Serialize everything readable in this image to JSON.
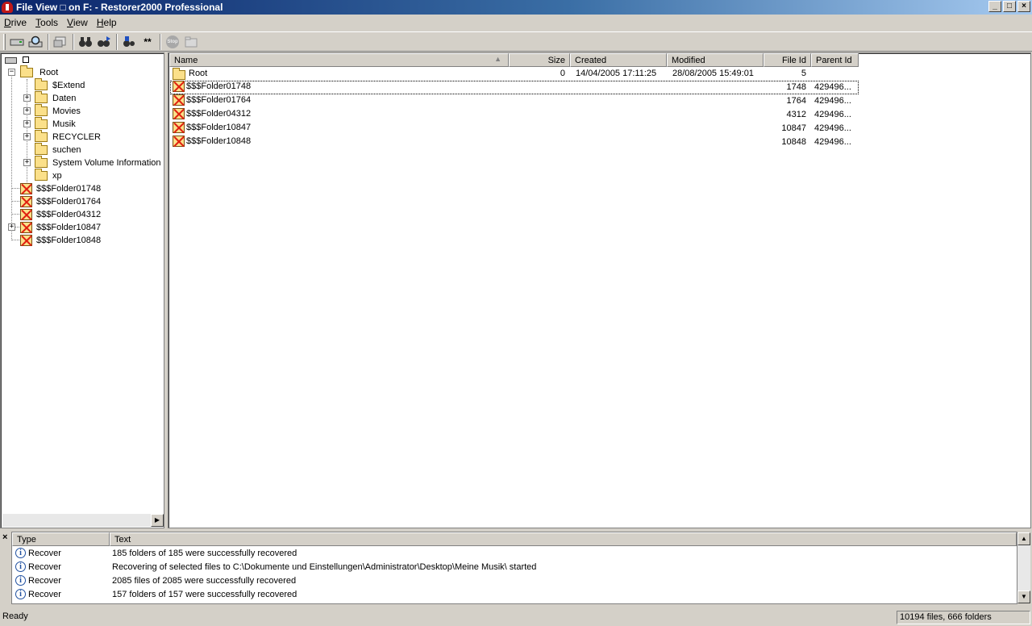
{
  "window": {
    "title": "File View □ on F: - Restorer2000 Professional",
    "controls": {
      "minimize": "_",
      "maximize": "□",
      "close": "×"
    }
  },
  "menu": [
    "Drive",
    "Tools",
    "View",
    "Help"
  ],
  "toolbar": {
    "buttons": [
      "open-drive-icon",
      "scan-icon",
      "recover-icon",
      "find-icon",
      "find-next-icon",
      "mask-icon",
      "wildcard-icon",
      "stop-icon",
      "folder-icon"
    ],
    "wildcard_label": "**",
    "stop_label": "Stop"
  },
  "tree": {
    "root_box": "□",
    "root": "Root",
    "children": [
      "$Extend",
      "Daten",
      "Movies",
      "Musik",
      "RECYCLER",
      "suchen",
      "System Volume Information",
      "xp"
    ],
    "deleted": [
      "$$$Folder01748",
      "$$$Folder01764",
      "$$$Folder04312",
      "$$$Folder10847",
      "$$$Folder10848"
    ],
    "expand_symbol": "+",
    "collapse_symbol": "−"
  },
  "list": {
    "columns": [
      "Name",
      "Size",
      "Created",
      "Modified",
      "File Id",
      "Parent Id"
    ],
    "sort_indicator": "▲",
    "rows": [
      {
        "name": "Root",
        "size": "0",
        "created": "14/04/2005 17:11:25",
        "modified": "28/08/2005 15:49:01",
        "file_id": "5",
        "parent_id": "",
        "deleted": false
      },
      {
        "name": "$$$Folder01748",
        "size": "",
        "created": "",
        "modified": "",
        "file_id": "1748",
        "parent_id": "429496...",
        "deleted": true
      },
      {
        "name": "$$$Folder01764",
        "size": "",
        "created": "",
        "modified": "",
        "file_id": "1764",
        "parent_id": "429496...",
        "deleted": true
      },
      {
        "name": "$$$Folder04312",
        "size": "",
        "created": "",
        "modified": "",
        "file_id": "4312",
        "parent_id": "429496...",
        "deleted": true
      },
      {
        "name": "$$$Folder10847",
        "size": "",
        "created": "",
        "modified": "",
        "file_id": "10847",
        "parent_id": "429496...",
        "deleted": true
      },
      {
        "name": "$$$Folder10848",
        "size": "",
        "created": "",
        "modified": "",
        "file_id": "10848",
        "parent_id": "429496...",
        "deleted": true
      }
    ]
  },
  "log": {
    "close_symbol": "×",
    "columns": [
      "Type",
      "Text"
    ],
    "info_glyph": "i",
    "entries": [
      {
        "type": "Recover",
        "text": "185 folders of 185 were successfully recovered"
      },
      {
        "type": "Recover",
        "text": "Recovering of selected files to C:\\Dokumente und Einstellungen\\Administrator\\Desktop\\Meine Musik\\ started"
      },
      {
        "type": "Recover",
        "text": "2085 files of 2085 were successfully recovered"
      },
      {
        "type": "Recover",
        "text": "157 folders of 157 were successfully recovered"
      }
    ]
  },
  "status": {
    "left": "Ready",
    "right": "10194 files, 666 folders"
  },
  "scroll_glyphs": {
    "right": "▶",
    "up": "▲",
    "down": "▼"
  }
}
